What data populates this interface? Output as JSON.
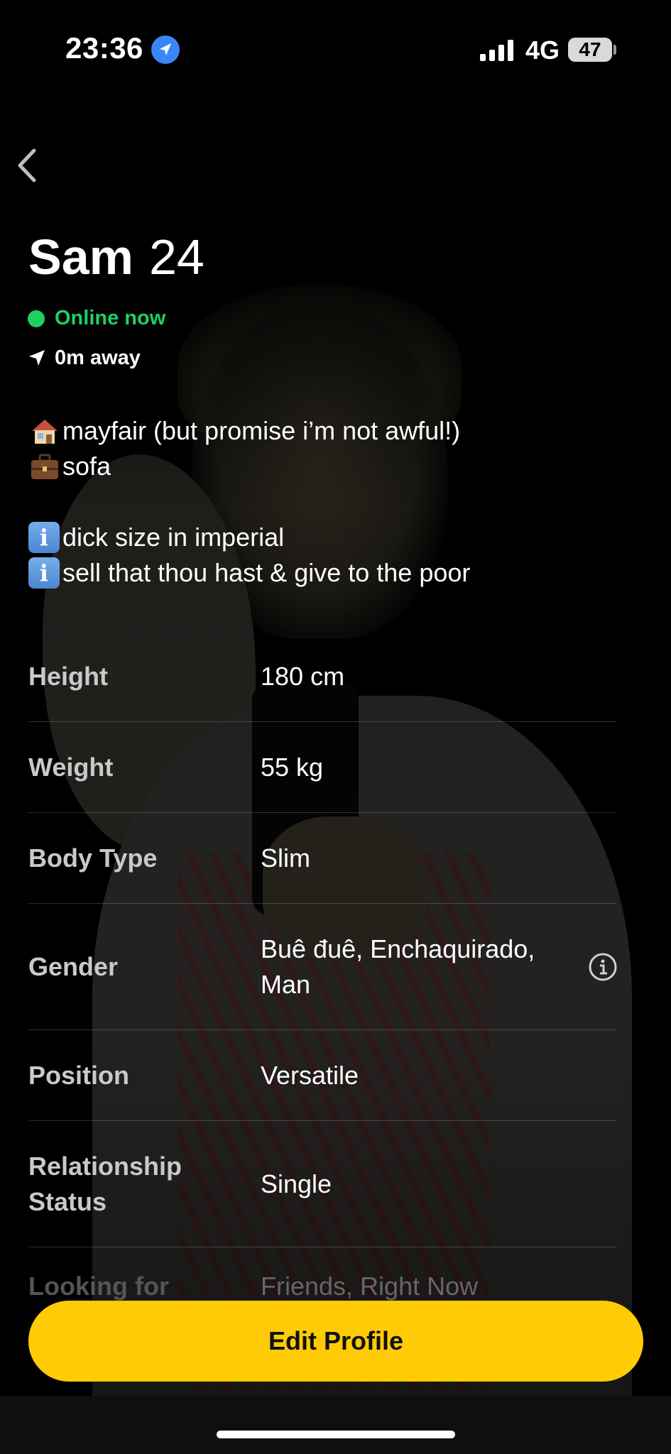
{
  "status_bar": {
    "time": "23:36",
    "network": "4G",
    "battery": "47"
  },
  "profile": {
    "name": "Sam",
    "age": "24",
    "online_status": "Online now",
    "distance": "0m away"
  },
  "bio": {
    "lines": [
      {
        "icon": "house-emoji",
        "text": "mayfair (but promise i’m not awful!)"
      },
      {
        "icon": "briefcase-emoji",
        "text": "sofa"
      },
      {
        "icon": "information-emoji",
        "text": "dick size in imperial"
      },
      {
        "icon": "information-emoji",
        "text": "sell that thou hast & give to the poor"
      }
    ]
  },
  "details": [
    {
      "label": "Height",
      "value": "180 cm"
    },
    {
      "label": "Weight",
      "value": "55 kg"
    },
    {
      "label": "Body Type",
      "value": "Slim"
    },
    {
      "label": "Gender",
      "value": "Buê đuê, Enchaquirado, Man"
    },
    {
      "label": "Position",
      "value": "Versatile"
    },
    {
      "label": "Relationship Status",
      "value": "Single"
    },
    {
      "label": "Looking for",
      "value": "Friends, Right Now"
    }
  ],
  "actions": {
    "edit_profile": "Edit Profile"
  },
  "colors": {
    "online": "#1fcf64",
    "button": "#ffcb05",
    "location_blue": "#3b86f6"
  }
}
